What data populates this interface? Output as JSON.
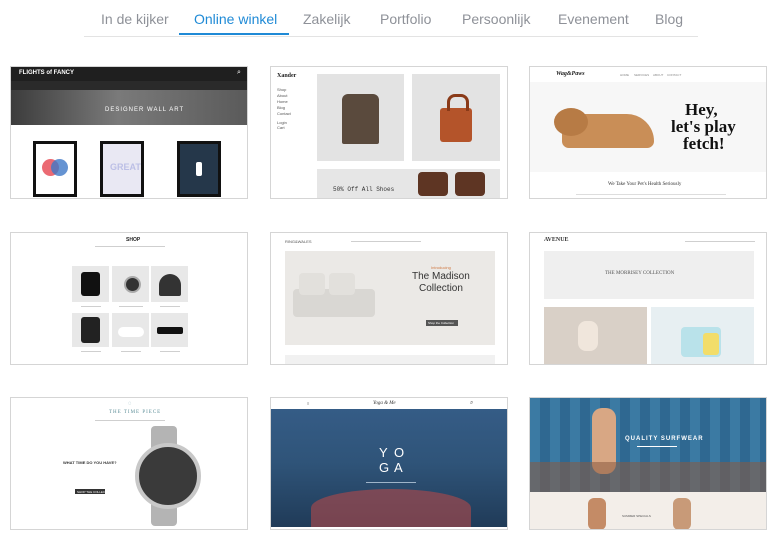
{
  "tabs": [
    {
      "label": "In de kijker",
      "active": false
    },
    {
      "label": "Online winkel",
      "active": true
    },
    {
      "label": "Zakelijk",
      "active": false
    },
    {
      "label": "Portfolio",
      "active": false
    },
    {
      "label": "Persoonlijk",
      "active": false
    },
    {
      "label": "Evenement",
      "active": false
    },
    {
      "label": "Blog",
      "active": false
    }
  ],
  "colors": {
    "accent": "#1f8ad6",
    "tab_text": "#8e9198"
  },
  "templates": {
    "t1": {
      "logo": "FLIGHTS of FANCY",
      "hero": "DESIGNER WALL ART",
      "poster2": "GREAT"
    },
    "t2": {
      "logo": "Xander",
      "nav": [
        "Shop",
        "About",
        "Home",
        "Blog",
        "Contact"
      ],
      "login": "Login",
      "cart": "Cart",
      "sale": "50% Off All Shoes"
    },
    "t3": {
      "logo": "Wag&Paws",
      "nav": [
        "HOME",
        "SERVICES",
        "ABOUT",
        "CONTACT"
      ],
      "heading": [
        "Hey,",
        "let's play",
        "fetch!"
      ],
      "tagline": "We Take Your Pet's Health Seriously"
    },
    "t4": {
      "logo": "SHOP"
    },
    "t5": {
      "logo": "RING&WALES",
      "kicker": "Introducing",
      "title": [
        "The Madison",
        "Collection"
      ],
      "button": "Shop the Collection"
    },
    "t6": {
      "logo": "AVENUE",
      "banner": "THE MORRISEY COLLECTION"
    },
    "t7": {
      "logo": "THE TIME PIECE",
      "question": "WHAT TIME DO YOU HAVE?",
      "button": "SHOP THE COLLECTION"
    },
    "t8": {
      "logo": "Yoga & Me",
      "letters": [
        "Y",
        "O",
        "G",
        "A"
      ]
    },
    "t9": {
      "hero": "QUALITY SURFWEAR",
      "promo": "SUMMER SPECIALS"
    }
  }
}
